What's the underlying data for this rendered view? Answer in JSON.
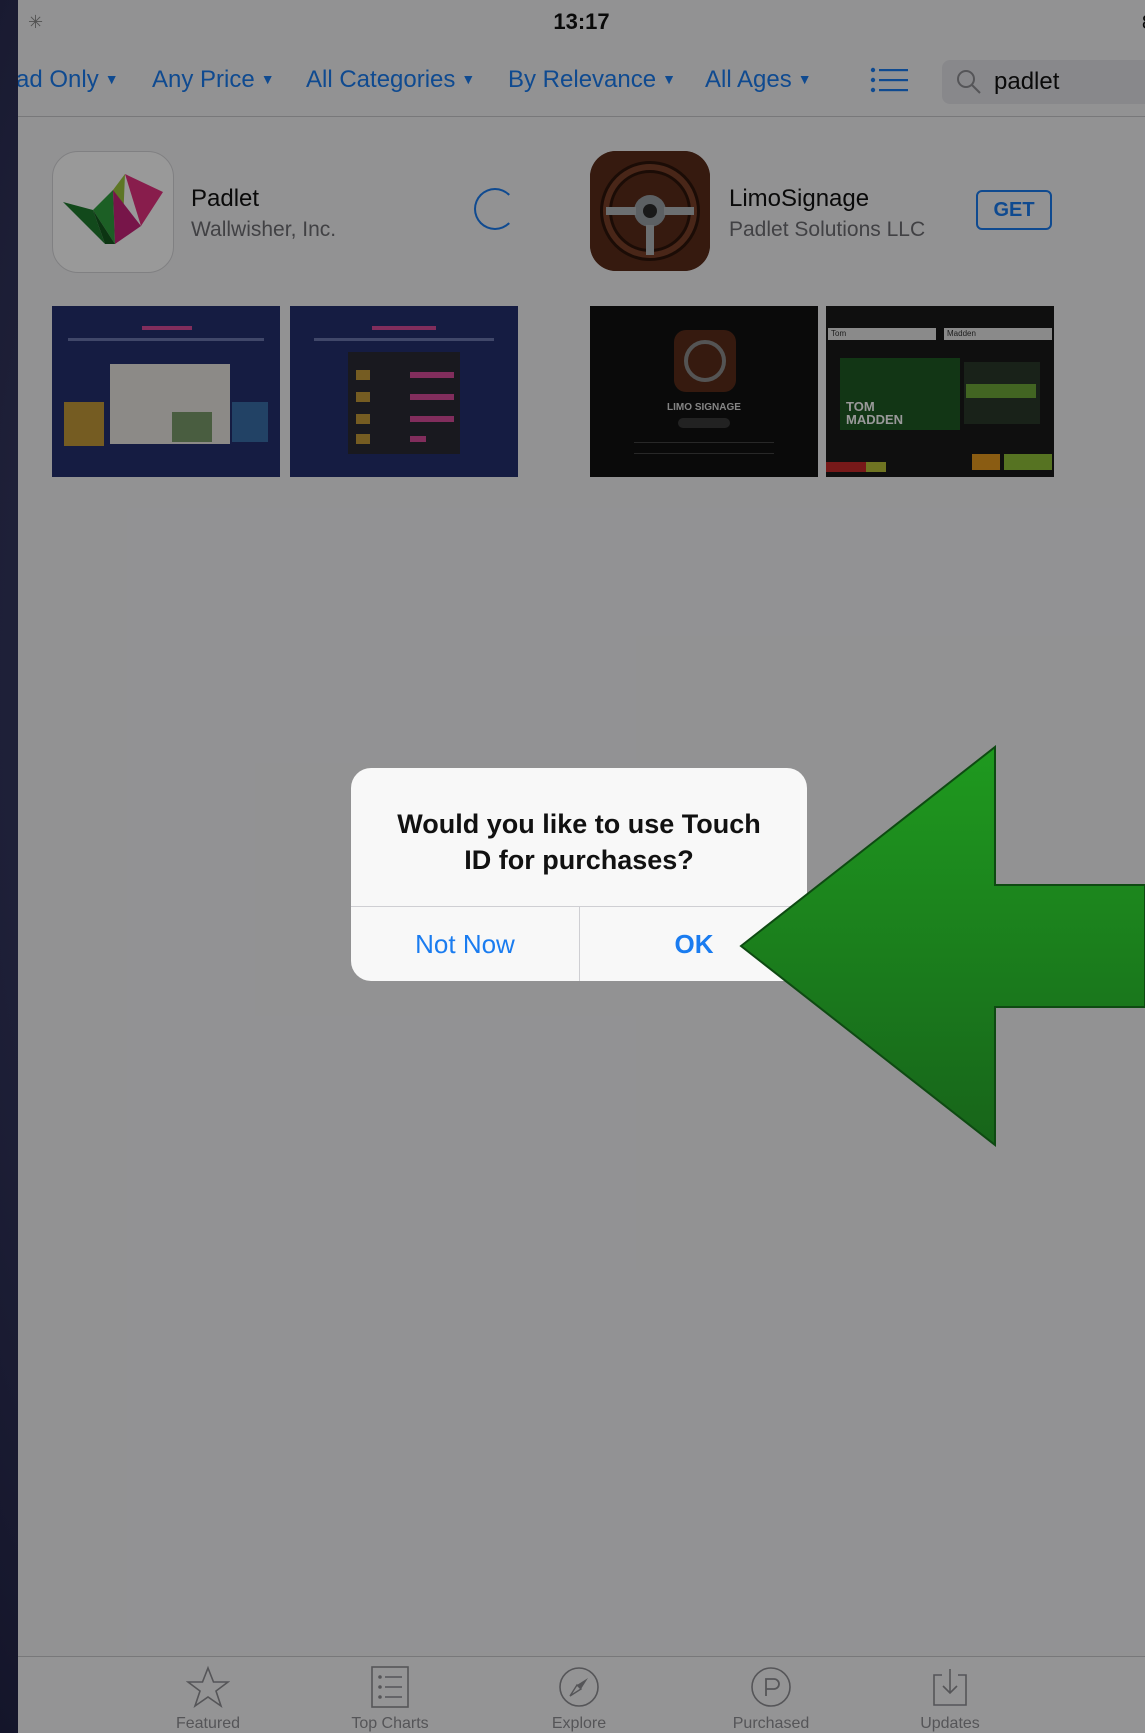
{
  "status_bar": {
    "time": "13:17",
    "battery": "8"
  },
  "filters": [
    {
      "label": "ad Only"
    },
    {
      "label": "Any Price"
    },
    {
      "label": "All Categories"
    },
    {
      "label": "By Relevance"
    },
    {
      "label": "All Ages"
    }
  ],
  "search": {
    "value": "padlet"
  },
  "results": [
    {
      "name": "Padlet",
      "developer": "Wallwisher, Inc."
    },
    {
      "name": "LimoSignage",
      "developer": "Padlet Solutions LLC",
      "action": "GET"
    }
  ],
  "screenshots": {
    "limo_title": "LIMO SIGNAGE",
    "tom": "Tom",
    "madden": "Madden",
    "tom_madden_1": "TOM",
    "tom_madden_2": "MADDEN"
  },
  "dialog": {
    "message": "Would you like to use Touch ID for purchases?",
    "cancel": "Not Now",
    "confirm": "OK"
  },
  "tab_bar": [
    {
      "label": "Featured",
      "icon": "star-icon"
    },
    {
      "label": "Top Charts",
      "icon": "list-icon"
    },
    {
      "label": "Explore",
      "icon": "compass-icon"
    },
    {
      "label": "Purchased",
      "icon": "purchased-icon"
    },
    {
      "label": "Updates",
      "icon": "download-icon"
    }
  ],
  "colors": {
    "accent": "#1a7cf0",
    "arrow": "#1f8a1f",
    "padlet_bg": "#23306e"
  }
}
